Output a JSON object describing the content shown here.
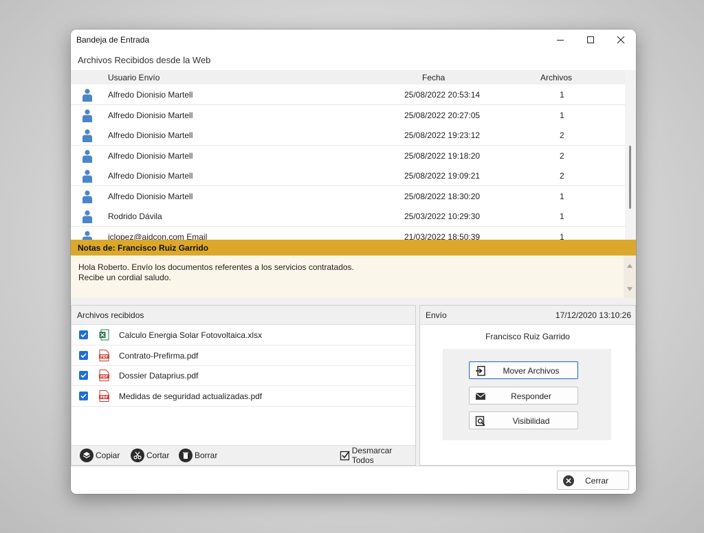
{
  "window": {
    "title": "Bandeja de Entrada"
  },
  "section_title": "Archivos Recibidos desde la Web",
  "table": {
    "headers": [
      "Usuario Envío",
      "Fecha",
      "Archivos"
    ],
    "rows": [
      {
        "user": "Alfredo Dionisio Martell",
        "date": "25/08/2022 20:53:14",
        "files": "1"
      },
      {
        "user": "Alfredo Dionisio Martell",
        "date": "25/08/2022 20:27:05",
        "files": "1"
      },
      {
        "user": "Alfredo Dionisio Martell",
        "date": "25/08/2022 19:23:12",
        "files": "2"
      },
      {
        "user": "Alfredo Dionisio Martell",
        "date": "25/08/2022 19:18:20",
        "files": "2"
      },
      {
        "user": "Alfredo Dionisio Martell",
        "date": "25/08/2022 19:09:21",
        "files": "2"
      },
      {
        "user": "Alfredo Dionisio Martell",
        "date": "25/08/2022 18:30:20",
        "files": "1"
      },
      {
        "user": "Rodrido Dávila",
        "date": "25/03/2022 10:29:30",
        "files": "1"
      },
      {
        "user": "jclopez@aidcon.com Email",
        "date": "21/03/2022 18:50:39",
        "files": "1"
      }
    ]
  },
  "notes": {
    "header": "Notas de: Francisco Ruiz Garrido",
    "line1": "Hola Roberto. Envío los documentos referentes a los servicios contratados.",
    "line2": "Recibe un cordial saludo."
  },
  "received_files": {
    "header": "Archivos recibidos",
    "files": [
      {
        "name": "Calculo Energia Solar Fotovoltaica.xlsx",
        "type": "xlsx",
        "checked": true
      },
      {
        "name": "Contrato-Prefirma.pdf",
        "type": "pdf",
        "checked": true
      },
      {
        "name": "Dossier Dataprius.pdf",
        "type": "pdf",
        "checked": true
      },
      {
        "name": "Medidas de seguridad actualizadas.pdf",
        "type": "pdf",
        "checked": true
      }
    ],
    "toolbar": {
      "copy": "Copiar",
      "cut": "Cortar",
      "delete": "Borrar",
      "uncheck_all": "Desmarcar Todos"
    }
  },
  "send_panel": {
    "header": "Envío",
    "date": "17/12/2020 13:10:26",
    "sender": "Francisco Ruiz Garrido",
    "move_button": "Mover Archivos",
    "reply_button": "Responder",
    "visibility_button": "Visibilidad"
  },
  "footer": {
    "close_button": "Cerrar"
  },
  "colors": {
    "notes_bar": "#dba82b",
    "user_icon": "#4a86c8",
    "checkbox": "#1f6fd1",
    "pdf_icon": "#d23a2f",
    "xlsx_icon": "#1e7e45"
  }
}
